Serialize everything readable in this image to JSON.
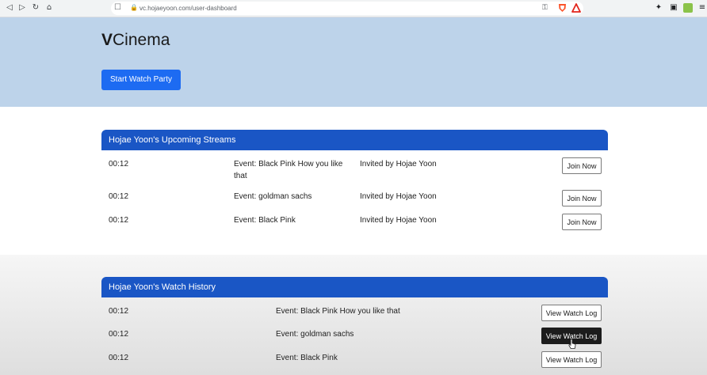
{
  "browser": {
    "url": "vc.hojaeyoon.com/user-dashboard",
    "icons": [
      "back-icon",
      "forward-icon",
      "reload-icon",
      "home-icon",
      "bookmark-icon",
      "lock-icon",
      "key-icon",
      "brave-shield-icon",
      "brave-rewards-icon",
      "extensions-puzzle-icon",
      "media-icon",
      "notes-extension-icon",
      "menu-icon"
    ]
  },
  "header": {
    "brand_strong": "V",
    "brand_rest": "Cinema",
    "start_button": "Start Watch Party"
  },
  "upcoming": {
    "title": "Hojae Yoon's Upcoming Streams",
    "rows": [
      {
        "time": "00:12",
        "event": "Event: Black Pink How you like that",
        "invited": "Invited by Hojae Yoon",
        "button": "Join Now"
      },
      {
        "time": "00:12",
        "event": "Event: goldman sachs",
        "invited": "Invited by Hojae Yoon",
        "button": "Join Now"
      },
      {
        "time": "00:12",
        "event": "Event: Black Pink",
        "invited": "Invited by Hojae Yoon",
        "button": "Join Now"
      }
    ]
  },
  "history": {
    "title": "Hojae Yoon's Watch History",
    "rows": [
      {
        "time": "00:12",
        "event": "Event: Black Pink How you like that",
        "button": "View Watch Log"
      },
      {
        "time": "00:12",
        "event": "Event: goldman sachs",
        "button": "View Watch Log"
      },
      {
        "time": "00:12",
        "event": "Event: Black Pink",
        "button": "View Watch Log"
      }
    ]
  },
  "colors": {
    "header_bg": "#bdd3ea",
    "primary": "#1d6bf2",
    "card_header": "#1a56c5"
  }
}
